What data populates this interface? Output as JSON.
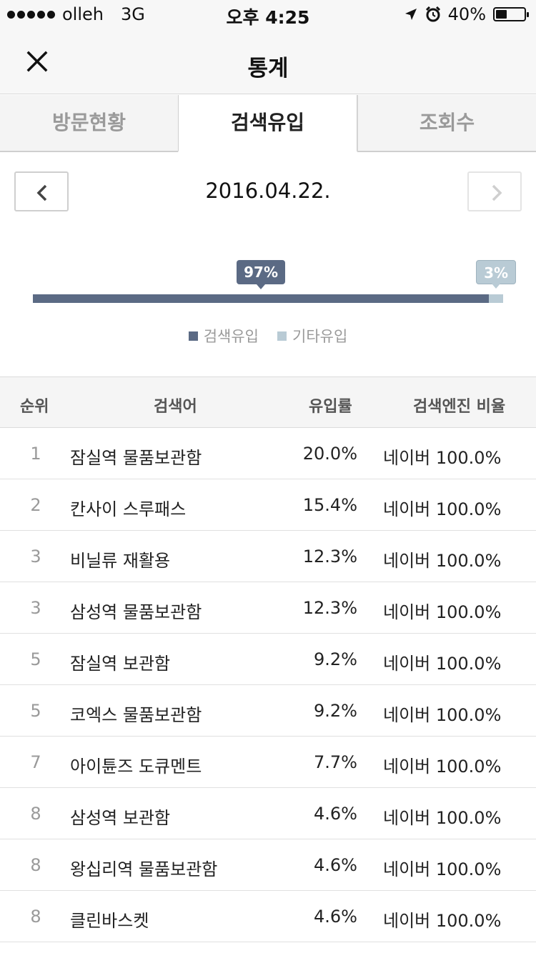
{
  "status_bar": {
    "carrier": "olleh",
    "network": "3G",
    "time": "오후 4:25",
    "battery": "40%",
    "battery_level": 0.4
  },
  "header": {
    "title": "통계"
  },
  "tabs": [
    {
      "label": "방문현황",
      "active": false
    },
    {
      "label": "검색유입",
      "active": true
    },
    {
      "label": "조회수",
      "active": false
    }
  ],
  "date": "2016.04.22.",
  "traffic": {
    "search_percent": 97,
    "other_percent": 3,
    "search_label": "97%",
    "other_label": "3%",
    "legend_search": "검색유입",
    "legend_other": "기타유입",
    "search_color": "#5b6a84",
    "other_color": "#b9cbd5"
  },
  "table": {
    "headers": {
      "rank": "순위",
      "keyword": "검색어",
      "rate": "유입률",
      "engine": "검색엔진 비율"
    },
    "rows": [
      {
        "rank": "1",
        "keyword": "잠실역 물품보관함",
        "rate": "20.0%",
        "engine": "네이버 100.0%"
      },
      {
        "rank": "2",
        "keyword": "칸사이 스루패스",
        "rate": "15.4%",
        "engine": "네이버 100.0%"
      },
      {
        "rank": "3",
        "keyword": "비닐류 재활용",
        "rate": "12.3%",
        "engine": "네이버 100.0%"
      },
      {
        "rank": "3",
        "keyword": "삼성역 물품보관함",
        "rate": "12.3%",
        "engine": "네이버 100.0%"
      },
      {
        "rank": "5",
        "keyword": "잠실역 보관함",
        "rate": "9.2%",
        "engine": "네이버 100.0%"
      },
      {
        "rank": "5",
        "keyword": "코엑스 물품보관함",
        "rate": "9.2%",
        "engine": "네이버 100.0%"
      },
      {
        "rank": "7",
        "keyword": "아이튠즈 도큐멘트",
        "rate": "7.7%",
        "engine": "네이버 100.0%"
      },
      {
        "rank": "8",
        "keyword": "삼성역 보관함",
        "rate": "4.6%",
        "engine": "네이버 100.0%"
      },
      {
        "rank": "8",
        "keyword": "왕십리역 물품보관함",
        "rate": "4.6%",
        "engine": "네이버 100.0%"
      },
      {
        "rank": "8",
        "keyword": "클린바스켓",
        "rate": "4.6%",
        "engine": "네이버 100.0%"
      }
    ]
  }
}
